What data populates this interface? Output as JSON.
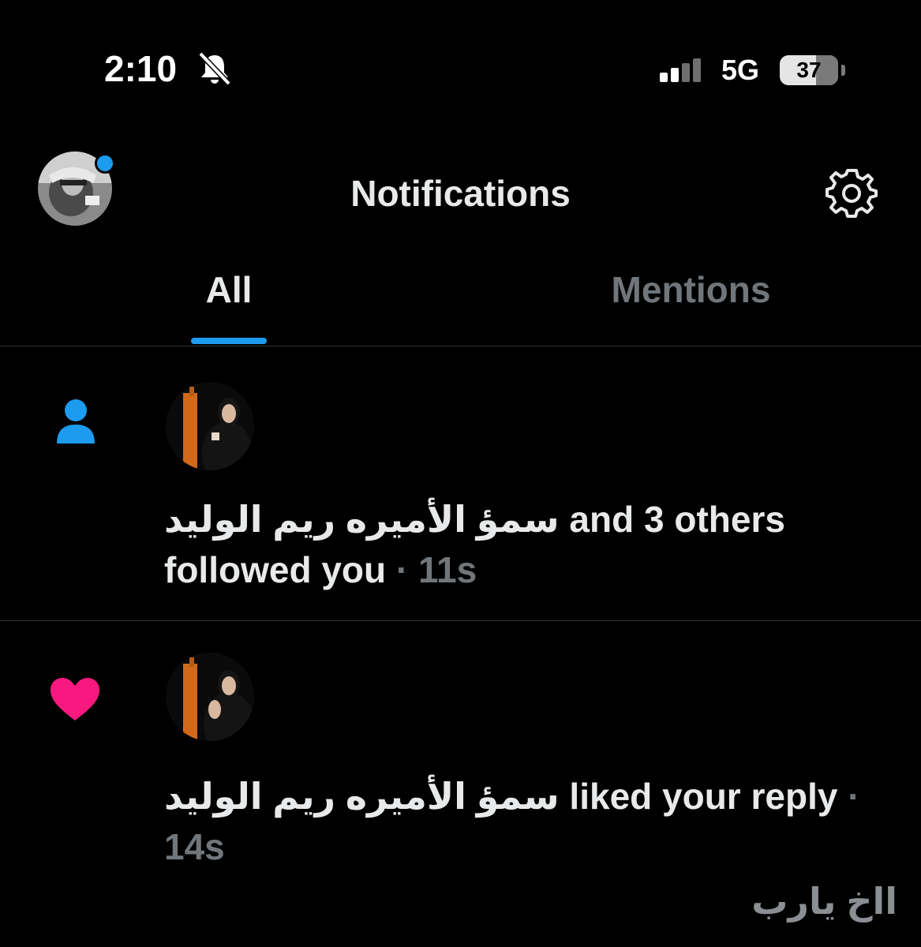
{
  "status_bar": {
    "time": "2:10",
    "network": "5G",
    "battery": "37",
    "silent_icon": "bell-slash-icon",
    "signal_icon": "cellular-signal-icon"
  },
  "header": {
    "title": "Notifications",
    "settings_icon": "gear-icon"
  },
  "tabs": [
    {
      "label": "All",
      "selected": true
    },
    {
      "label": "Mentions",
      "selected": false
    }
  ],
  "accent_color": "#1d9bf0",
  "like_color": "#f91880",
  "notifications": [
    {
      "type_icon": "person-icon",
      "actor": "سمؤ الأميره ريم الوليد",
      "action": "and 3 others followed you",
      "separator": "·",
      "time": "11s"
    },
    {
      "type_icon": "heart-icon",
      "actor": "سمؤ الأميره ريم الوليد",
      "action": "liked your reply",
      "separator": "·",
      "time": "14s"
    }
  ],
  "caption": "ااخ يارب"
}
